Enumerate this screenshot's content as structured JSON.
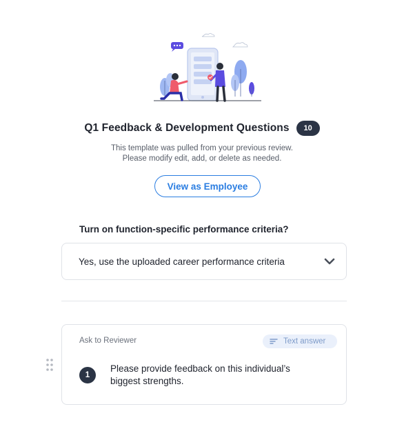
{
  "header": {
    "title": "Q1 Feedback & Development Questions",
    "question_count": "10",
    "subtitle_line1": "This template was pulled from your previous review.",
    "subtitle_line2": "Please modify edit, add, or delete as needed.",
    "view_button_label": "View as Employee"
  },
  "criteria": {
    "question": "Turn on function-specific performance criteria?",
    "selected_option": "Yes, use the uploaded career performance criteria",
    "dropdown_icon": "chevron-down-icon"
  },
  "question_card": {
    "ask_label": "Ask to Reviewer",
    "answer_type_icon": "text-lines-icon",
    "answer_type_label": "Text answer",
    "number": "1",
    "text": "Please provide feedback on this individual’s biggest strengths."
  },
  "colors": {
    "accent_blue": "#2a7de1",
    "dark_badge": "#2b3445",
    "pill_bg": "#eaf0fb",
    "border": "#dfe2e7",
    "illustration_purple": "#5b4ce0",
    "illustration_red": "#ef5b6b",
    "illustration_light_blue": "#9fb8f2"
  }
}
